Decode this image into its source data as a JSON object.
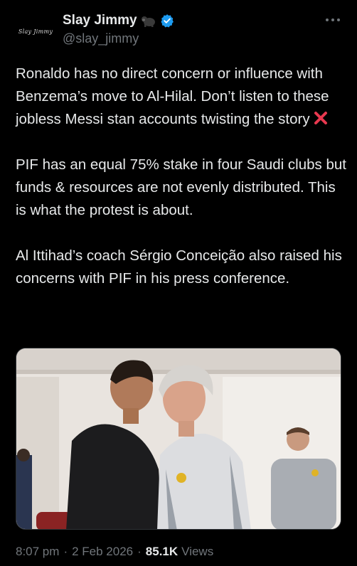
{
  "author": {
    "display_name": "Slay Jimmy",
    "handle": "@slay_jimmy",
    "avatar_text": "Slay Jimmy",
    "verified": true,
    "name_emoji": "gorilla-icon",
    "verified_color": "#1d9bf0"
  },
  "tweet": {
    "paragraphs": [
      "Ronaldo has no direct concern or influence with Benzema’s move to Al-Hilal. Don’t listen to these jobless Messi stan accounts twisting the story",
      "PIF has an equal 75% stake in four Saudi clubs but funds & resources are not evenly distributed. This is what the protest is about.",
      "Al Ittihad’s coach Sérgio Conceição also raised his concerns with PIF in his press conference."
    ],
    "trailing_emoji": "cross-mark-icon"
  },
  "media": {
    "type": "photo",
    "description_icon": "photo-icon"
  },
  "footer": {
    "time": "8:07 pm",
    "separator": "·",
    "date": "2 Feb 2026",
    "views_count": "85.1K",
    "views_label": "Views"
  },
  "colors": {
    "background": "#000000",
    "text_primary": "#e7e9ea",
    "text_secondary": "#71767b",
    "cross_mark": "#e8384f"
  }
}
